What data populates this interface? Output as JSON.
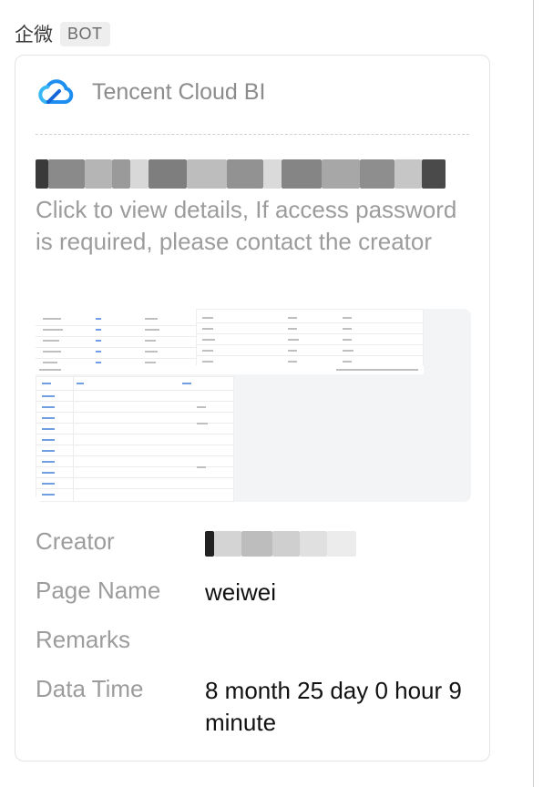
{
  "sender": {
    "name": "企微",
    "badge": "BOT"
  },
  "card": {
    "app_icon": "tencent-cloud-icon",
    "app_name": "Tencent Cloud BI",
    "description": "Click to view details, If access password is required, please contact the creator",
    "preview_image": "dashboard-preview-thumbnail",
    "fields": [
      {
        "label": "Creator",
        "value": ""
      },
      {
        "label": "Page Name",
        "value": "weiwei"
      },
      {
        "label": "Remarks",
        "value": ""
      },
      {
        "label": "Data Time",
        "value": "8 month 25 day 0 hour 9 minute"
      }
    ]
  },
  "colors": {
    "accent_blue": "#1e8ff0",
    "label_gray": "#9c9c9c",
    "value_black": "#111111"
  }
}
